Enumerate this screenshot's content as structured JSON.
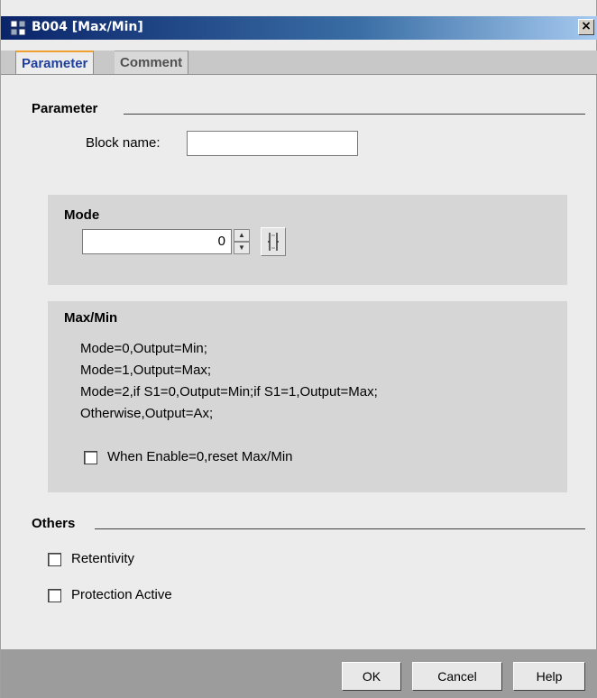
{
  "window": {
    "title": "B004 [Max/Min]",
    "close_label": "×"
  },
  "tabs": [
    {
      "label": "Parameter",
      "active": true
    },
    {
      "label": "Comment",
      "active": false
    }
  ],
  "parameter_section": {
    "heading": "Parameter",
    "block_name_label": "Block name:",
    "block_name_value": ""
  },
  "mode_panel": {
    "title": "Mode",
    "value": "0",
    "spin_up": "▲",
    "spin_down": "▼"
  },
  "maxmin_panel": {
    "title": "Max/Min",
    "lines": [
      "Mode=0,Output=Min;",
      "Mode=1,Output=Max;",
      "Mode=2,if S1=0,Output=Min;if S1=1,Output=Max;",
      "Otherwise,Output=Ax;"
    ],
    "reset_checkbox_label": "When Enable=0,reset Max/Min",
    "reset_checked": false
  },
  "others_section": {
    "heading": "Others",
    "retentivity_label": "Retentivity",
    "retentivity_checked": false,
    "protection_label": "Protection Active",
    "protection_checked": false
  },
  "buttons": {
    "ok": "OK",
    "cancel": "Cancel",
    "help": "Help"
  },
  "colors": {
    "titlebar_start": "#0a246a",
    "active_tab_text": "#1f3f9e",
    "tab_accent": "#f0a030",
    "panel_bg": "#d6d6d6",
    "footer_bg": "#9c9c9c"
  }
}
